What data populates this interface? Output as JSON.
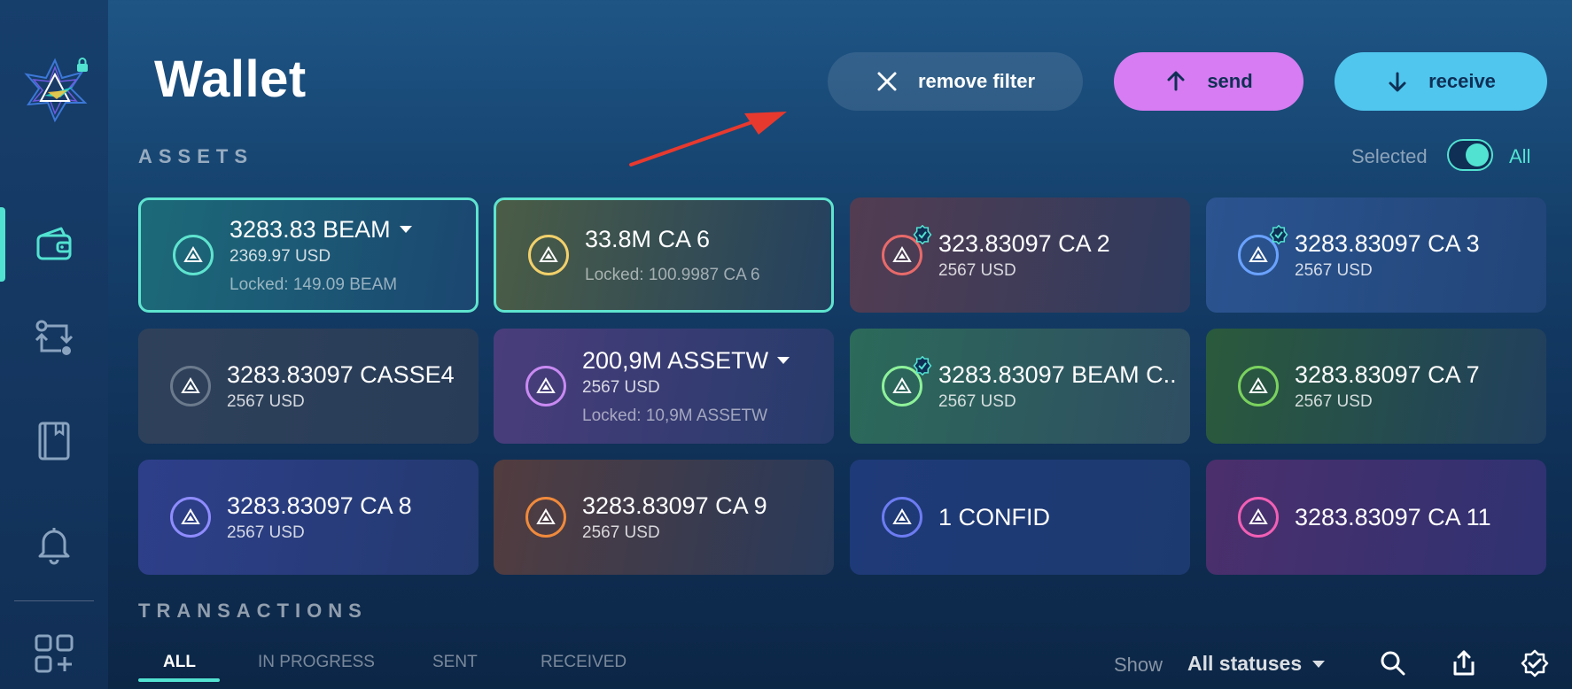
{
  "window": {
    "controls": [
      "close",
      "minimize",
      "maximize"
    ]
  },
  "sidebar": {
    "items": [
      {
        "name": "wallet-icon",
        "active": true
      },
      {
        "name": "swap-icon",
        "active": false
      },
      {
        "name": "address-book-icon",
        "active": false
      },
      {
        "name": "notifications-icon",
        "active": false
      },
      {
        "name": "apps-icon",
        "active": false
      }
    ]
  },
  "header": {
    "title": "Wallet",
    "remove_filter_label": "remove filter",
    "send_label": "send",
    "receive_label": "receive"
  },
  "assets": {
    "section_label": "ASSETS",
    "toggle_left": "Selected",
    "toggle_right": "All",
    "cards": [
      {
        "amount": "3283.83 BEAM",
        "usd": "2369.97 USD",
        "locked": "Locked: 149.09 BEAM",
        "color": "#5fe4cf",
        "dropdown": true,
        "selected": true,
        "verified": false
      },
      {
        "amount": "33.8M CA 6",
        "usd": "",
        "locked": "Locked: 100.9987 CA 6",
        "color": "#f2d16b",
        "dropdown": false,
        "selected": true,
        "verified": false
      },
      {
        "amount": "323.83097 CA 2",
        "usd": "2567 USD",
        "locked": "",
        "color": "#e86a6a",
        "dropdown": false,
        "selected": false,
        "verified": true
      },
      {
        "amount": "3283.83097 CA 3",
        "usd": "2567 USD",
        "locked": "",
        "color": "#6aa2ff",
        "dropdown": false,
        "selected": false,
        "verified": true
      },
      {
        "amount": "3283.83097 CASSE4",
        "usd": "2567 USD",
        "locked": "",
        "color": "#6b7a8c",
        "dropdown": false,
        "selected": false,
        "verified": false
      },
      {
        "amount": "200,9M ASSETW",
        "usd": "2567 USD",
        "locked": "Locked: 10,9M ASSETW",
        "color": "#c98af2",
        "dropdown": true,
        "selected": false,
        "verified": false
      },
      {
        "amount": "3283.83097 BEAM C..",
        "usd": "2567 USD",
        "locked": "",
        "color": "#8ef29a",
        "dropdown": false,
        "selected": false,
        "verified": true
      },
      {
        "amount": "3283.83097 CA 7",
        "usd": "2567 USD",
        "locked": "",
        "color": "#7bd25e",
        "dropdown": false,
        "selected": false,
        "verified": false
      },
      {
        "amount": "3283.83097 CA 8",
        "usd": "2567 USD",
        "locked": "",
        "color": "#8f8cff",
        "dropdown": false,
        "selected": false,
        "verified": false
      },
      {
        "amount": "3283.83097 CA 9",
        "usd": "2567 USD",
        "locked": "",
        "color": "#f08a3c",
        "dropdown": false,
        "selected": false,
        "verified": false
      },
      {
        "amount": "1 CONFID",
        "usd": "",
        "locked": "",
        "color": "#6d7cf2",
        "dropdown": false,
        "selected": false,
        "verified": false
      },
      {
        "amount": "3283.83097 CA 11",
        "usd": "",
        "locked": "",
        "color": "#f25fb5",
        "dropdown": false,
        "selected": false,
        "verified": false
      }
    ]
  },
  "transactions": {
    "section_label": "TRANSACTIONS",
    "tabs": [
      "ALL",
      "IN PROGRESS",
      "SENT",
      "RECEIVED"
    ],
    "active_tab": "ALL",
    "show_label": "Show",
    "status_filter": "All statuses",
    "tools": [
      "search-icon",
      "export-icon",
      "verify-icon"
    ]
  },
  "colors": {
    "accent": "#52e2d1",
    "send": "#d77cf2",
    "receive": "#50c6ee",
    "annotation_arrow": "#e8392e"
  }
}
